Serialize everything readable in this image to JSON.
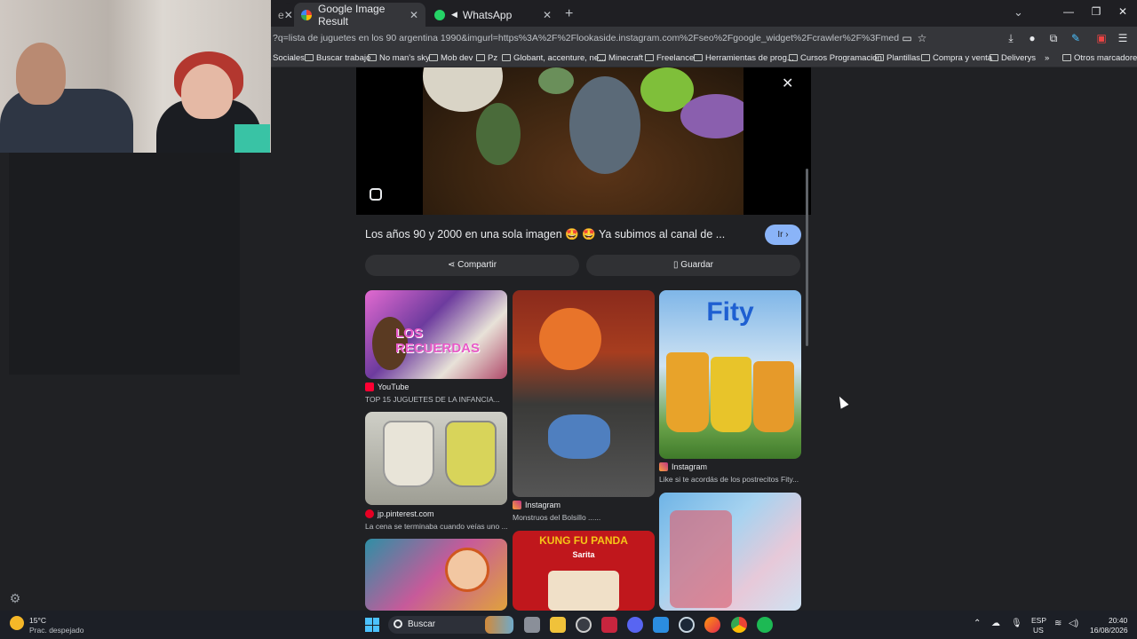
{
  "browser": {
    "tabs": [
      {
        "label": "e",
        "partial": true
      },
      {
        "label": "Google Image Result",
        "active": true,
        "icon": "google-icon"
      },
      {
        "label": "WhatsApp",
        "icon": "whatsapp-icon"
      }
    ],
    "url": "?q=lista de juguetes en los 90 argentina 1990&imgurl=https%3A%2F%2Flookaside.instagram.com%2Fseo%2Fgoogle_widget%2Fcrawler%2F%3Fmedia_id%3D38580639120560",
    "bookmarks": [
      "Sociales",
      "Buscar trabajo",
      "No man's sky",
      "Mob dev",
      "Pz",
      "Globant, accenture, ne...",
      "Minecraft",
      "Freelance",
      "Herramientas de prog...",
      "Cursos Programacion",
      "Plantillas",
      "Compra y venta",
      "Deliverys"
    ],
    "other_bookmarks": "Otros marcadores"
  },
  "viewer": {
    "caption": "Los años 90 y 2000 en una sola imagen 🤩 🤩 Ya subimos al canal de ...",
    "go_label": "Ir",
    "share_label": "Compartir",
    "save_label": "Guardar"
  },
  "results": [
    {
      "source": "YouTube",
      "title": "TOP 15 JUGUETES DE LA INFANCIA...",
      "overlay": "LOS RECUERDAS"
    },
    {
      "source": "jp.pinterest.com",
      "title": "La cena se terminaba cuando veías uno ..."
    },
    {
      "source": "Instagram",
      "title": "Monstruos del Bolsillo ......"
    },
    {
      "source": "Instagram",
      "title": "Like si te acordás de los postrecitos Fity...",
      "overlay": "Fity"
    },
    {
      "overlay_top": "KUNG FU PANDA",
      "overlay_sub": "Sarita"
    }
  ],
  "taskbar": {
    "weather_temp": "15°C",
    "weather_desc": "Prac. despejado",
    "search_placeholder": "Buscar",
    "lang_line1": "ESP",
    "lang_line2": "US",
    "time": "20:40",
    "date": "16/08/2026"
  },
  "colors": {
    "page_bg": "#202124",
    "accent": "#8ab4f8",
    "tab_active": "#35363a"
  }
}
